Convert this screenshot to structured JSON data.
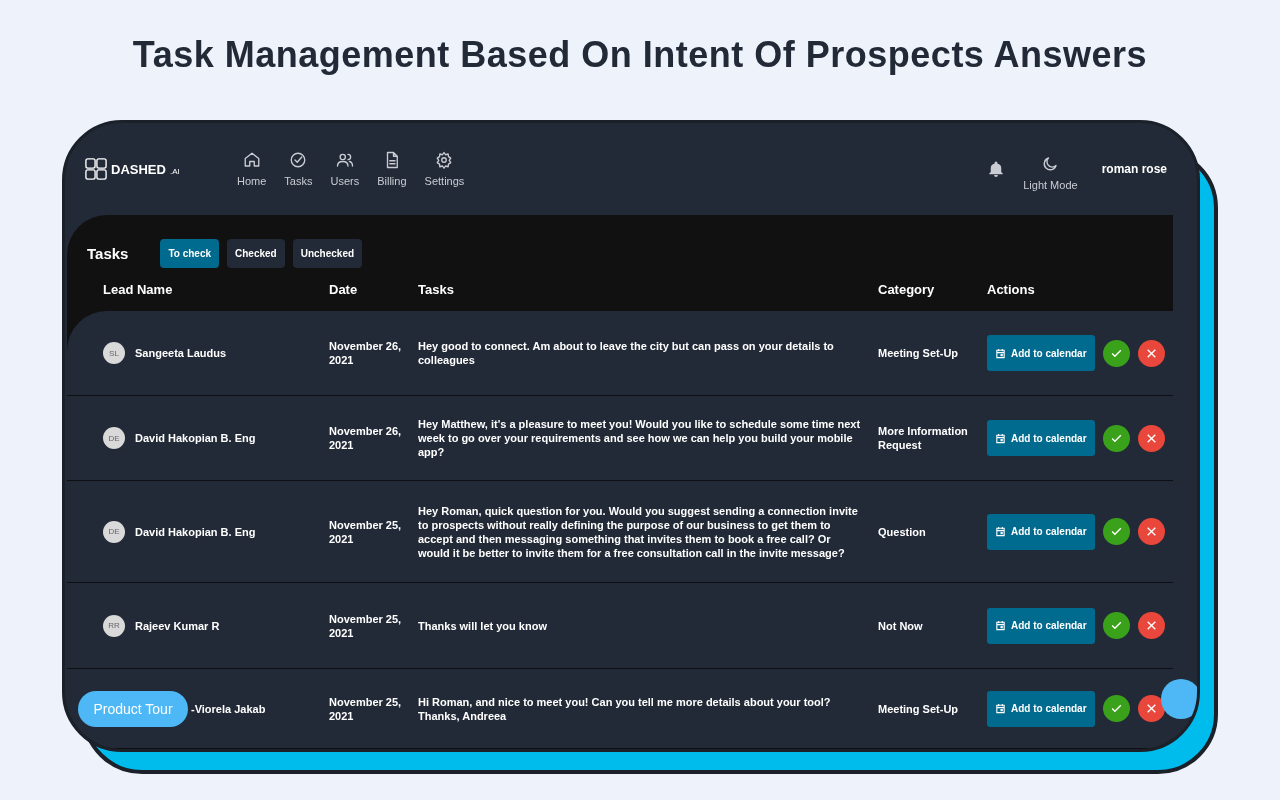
{
  "headline": "Task Management Based On Intent Of Prospects Answers",
  "logo": {
    "name": "DASHED",
    "suffix": ".AI"
  },
  "nav": [
    {
      "label": "Home"
    },
    {
      "label": "Tasks"
    },
    {
      "label": "Users"
    },
    {
      "label": "Billing"
    },
    {
      "label": "Settings"
    }
  ],
  "theme_toggle": "Light Mode",
  "user_name": "roman rose",
  "section_title": "Tasks",
  "tabs": [
    {
      "label": "To check",
      "selected": true
    },
    {
      "label": "Checked",
      "selected": false
    },
    {
      "label": "Unchecked",
      "selected": false
    }
  ],
  "columns": [
    "Lead Name",
    "Date",
    "Tasks",
    "Category",
    "Actions"
  ],
  "rows": [
    {
      "initials": "SL",
      "lead_name": "Sangeeta Laudus",
      "date": "November 26, 2021",
      "task": "Hey good to connect. Am about to leave the city but can pass on your details to colleagues",
      "category": "Meeting Set-Up",
      "action": "Add to calendar"
    },
    {
      "initials": "DE",
      "lead_name": "David Hakopian B. Eng",
      "date": "November 26, 2021",
      "task": "Hey Matthew, it's a pleasure to meet you! Would you like to schedule some time next week to go over your requirements and see how we can help you build your mobile app?",
      "category": "More Information Request",
      "action": "Add to calendar"
    },
    {
      "initials": "DE",
      "lead_name": "David Hakopian B. Eng",
      "date": "November 25, 2021",
      "task": "Hey Roman, quick question for you. Would you suggest sending a connection invite to prospects without really defining the purpose of our business to get them to accept and then messaging something that invites them to book a free call? Or would it be better to invite them for a free consultation call in the invite message?",
      "category": "Question",
      "action": "Add to calendar"
    },
    {
      "initials": "RR",
      "lead_name": "Rajeev Kumar R",
      "date": "November 25, 2021",
      "task": "Thanks will let you know",
      "category": "Not Now",
      "action": "Add to calendar"
    },
    {
      "lead_name": "-Viorela Jakab",
      "date": "November 25, 2021",
      "task": "Hi Roman, and nice to meet you! Can you tell me more details about your tool? Thanks, Andreea",
      "category": "Meeting Set-Up",
      "action": "Add to calendar"
    }
  ],
  "product_tour": "Product Tour"
}
